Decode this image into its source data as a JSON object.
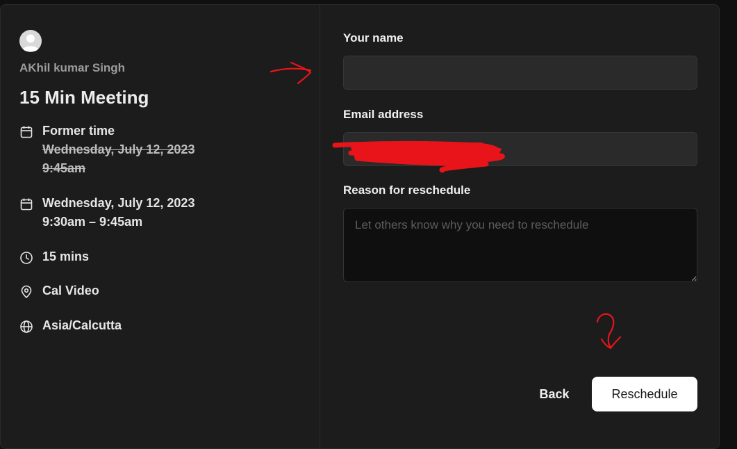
{
  "organizer": {
    "name": "AKhil kumar Singh"
  },
  "event": {
    "title": "15 Min Meeting",
    "former_label": "Former time",
    "former_date": "Wednesday, July 12, 2023",
    "former_time": "9:45am",
    "new_date": "Wednesday, July 12, 2023",
    "new_time": "9:30am – 9:45am",
    "duration": "15 mins",
    "location": "Cal Video",
    "timezone": "Asia/Calcutta"
  },
  "form": {
    "name_label": "Your name",
    "name_value": "",
    "email_label": "Email address",
    "email_value": "",
    "reason_label": "Reason for reschedule",
    "reason_placeholder": "Let others know why you need to reschedule"
  },
  "actions": {
    "back_label": "Back",
    "reschedule_label": "Reschedule"
  },
  "colors": {
    "background": "#1c1c1c",
    "primary_button": "#ffffff",
    "annotation": "#e8141a"
  },
  "icons": [
    "calendar-icon",
    "clock-icon",
    "map-pin-icon",
    "globe-icon"
  ]
}
